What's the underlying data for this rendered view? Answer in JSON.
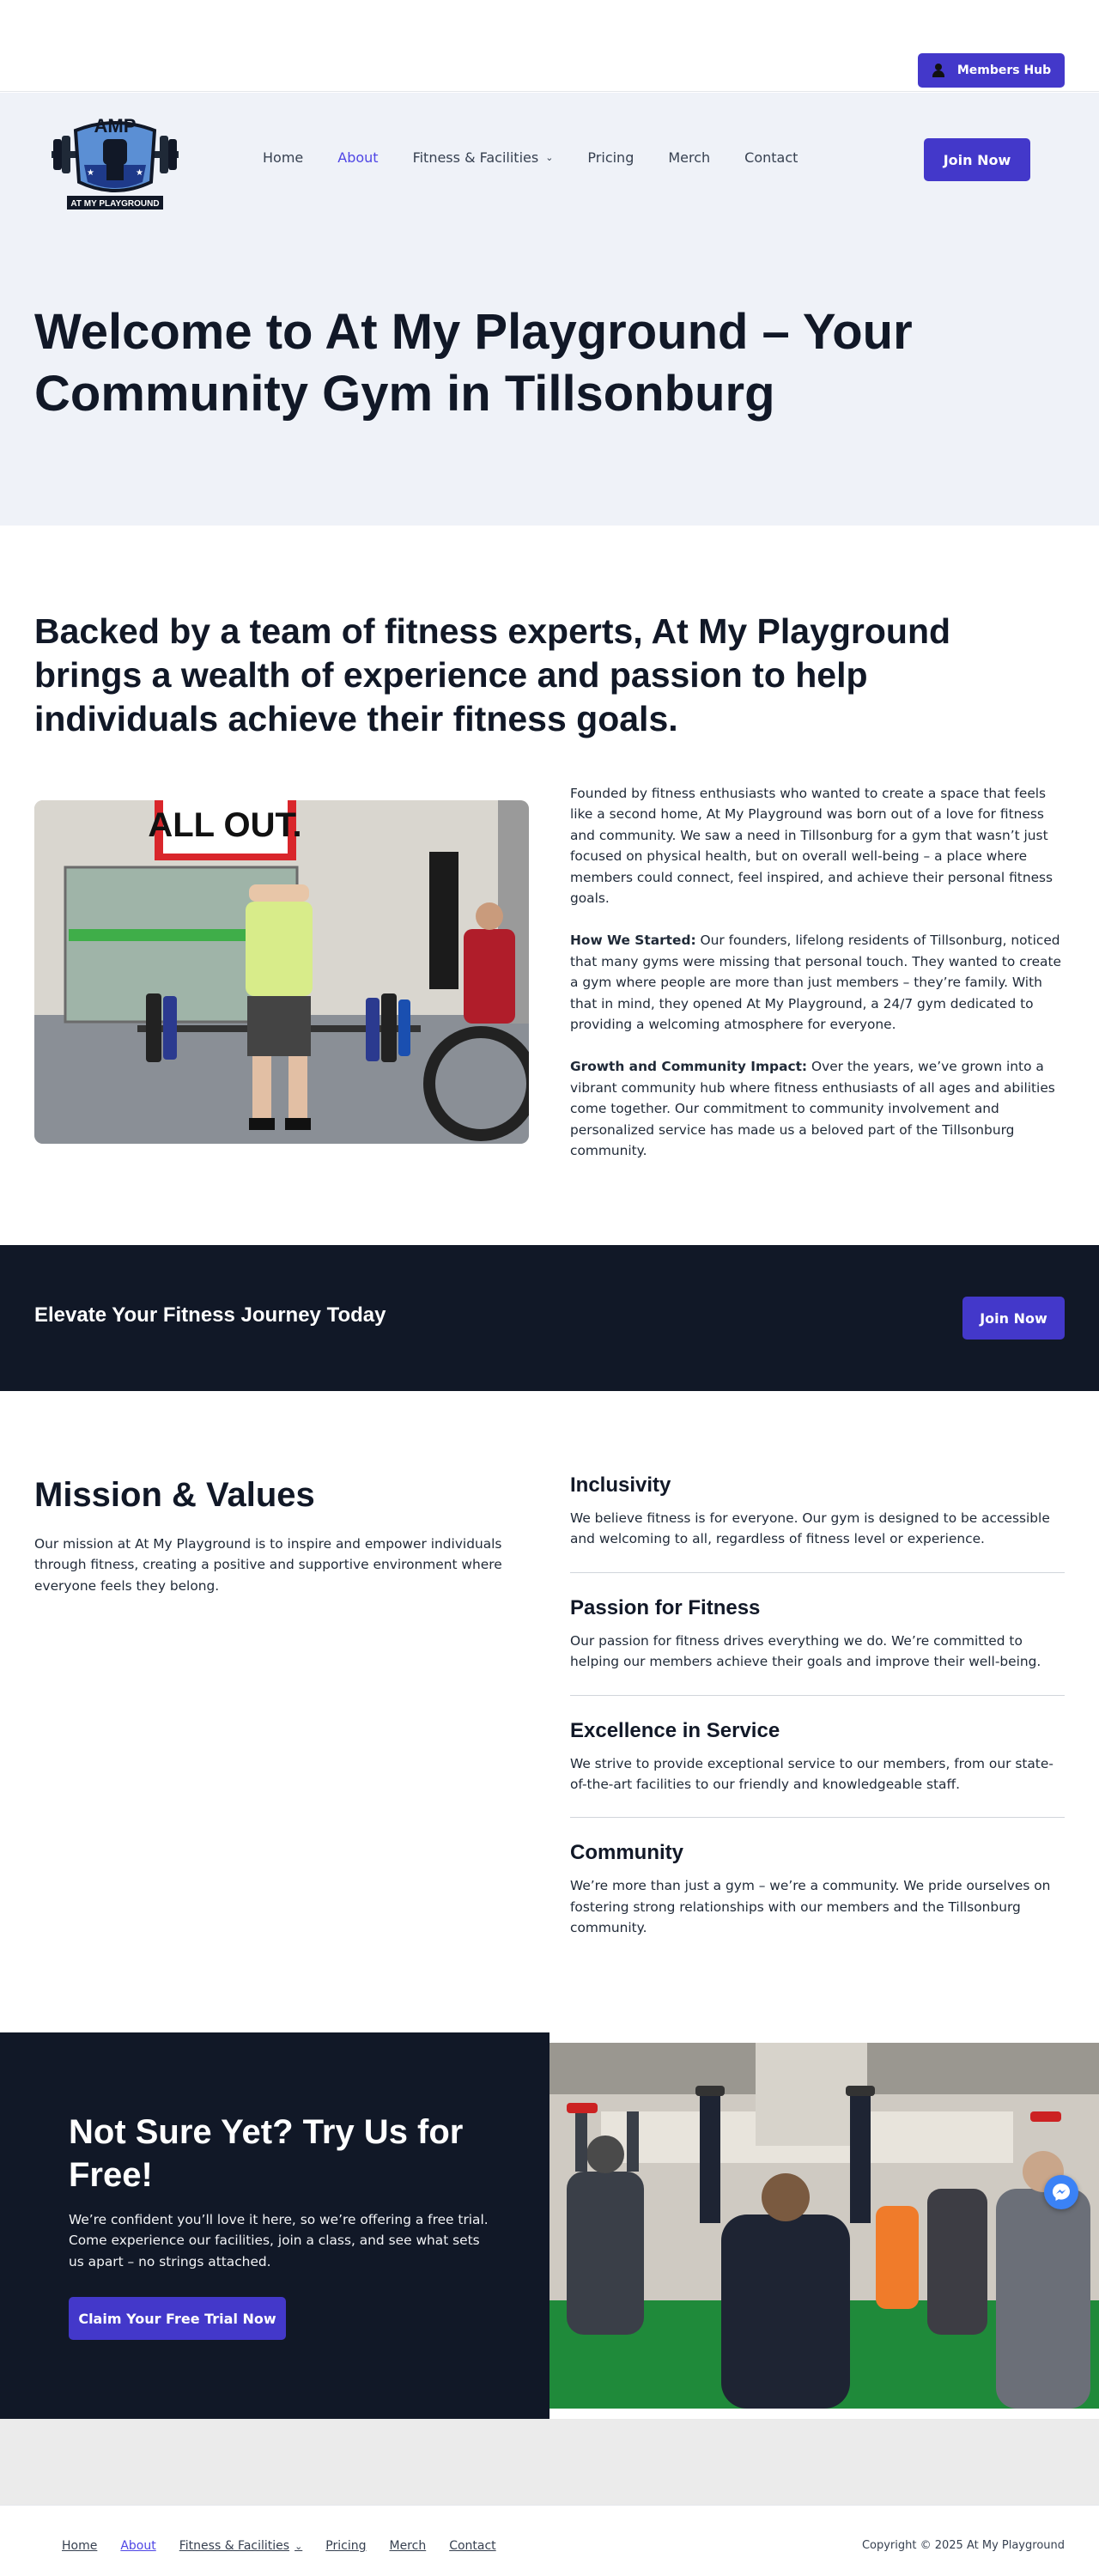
{
  "topbar": {
    "members_label": "Members Hub"
  },
  "logo": {
    "text_top": "AMP",
    "text_bottom": "AT MY PLAYGROUND"
  },
  "nav": {
    "items": [
      {
        "label": "Home"
      },
      {
        "label": "About",
        "active": true
      },
      {
        "label": "Fitness & Facilities",
        "dropdown": true
      },
      {
        "label": "Pricing"
      },
      {
        "label": "Merch"
      },
      {
        "label": "Contact"
      }
    ],
    "join_label": "Join Now"
  },
  "hero": {
    "title": "Welcome to At My Playground – Your Community Gym in Tillsonburg"
  },
  "about": {
    "heading": "Backed by a team of fitness experts, At My Playground brings a wealth of experience and passion to help individuals achieve their fitness goals.",
    "photo_sign": "ALL OUT.",
    "p1": "Founded by fitness enthusiasts who wanted to create a space that feels like a second home, At My Playground was born out of a love for fitness and community. We saw a need in Tillsonburg for a gym that wasn’t just focused on physical health, but on overall well-being – a place where members could connect, feel inspired, and achieve their personal fitness goals.",
    "p2_label": "How We Started:",
    "p2": " Our founders, lifelong residents of Tillsonburg, noticed that many gyms were missing that personal touch. They wanted to create a gym where people are more than just members – they’re family. With that in mind, they opened At My Playground, a 24/7 gym dedicated to providing a welcoming atmosphere for everyone.",
    "p3_label": "Growth and Community Impact:",
    "p3": " Over the years, we’ve grown into a vibrant community hub where fitness enthusiasts of all ages and abilities come together. Our commitment to community involvement and personalized service has made us a beloved part of the Tillsonburg community."
  },
  "cta": {
    "heading": "Elevate Your Fitness Journey Today",
    "button": "Join Now"
  },
  "mission": {
    "title": "Mission & Values",
    "text": "Our mission at At My Playground is to inspire and empower individuals through fitness, creating a positive and supportive environment where everyone feels they belong.",
    "values": [
      {
        "title": "Inclusivity",
        "text": "We believe fitness is for everyone. Our gym is designed to be accessible and welcoming to all, regardless of fitness level or experience."
      },
      {
        "title": "Passion for Fitness",
        "text": "Our passion for fitness drives everything we do. We’re committed to helping our members achieve their goals and improve their well-being."
      },
      {
        "title": "Excellence in Service",
        "text": "We strive to provide exceptional service to our members, from our state-of-the-art facilities to our friendly and knowledgeable staff."
      },
      {
        "title": "Community",
        "text": "We’re more than just a gym – we’re a community. We pride ourselves on fostering strong relationships with our members and the Tillsonburg community."
      }
    ]
  },
  "trial": {
    "heading": "Not Sure Yet? Try Us for Free!",
    "text": "We’re confident you’ll love it here, so we’re offering a free trial. Come experience our facilities, join a class, and see what sets us apart – no strings attached.",
    "button": "Claim Your Free Trial Now"
  },
  "footer": {
    "links": [
      {
        "label": "Home"
      },
      {
        "label": "About",
        "active": true
      },
      {
        "label": "Fitness & Facilities",
        "dropdown": true
      },
      {
        "label": "Pricing"
      },
      {
        "label": "Merch"
      },
      {
        "label": "Contact"
      }
    ],
    "copyright": "Copyright © 2025 At My Playground"
  },
  "colors": {
    "accent": "#4338ca",
    "dark": "#111827",
    "hero_bg": "#eff2f8",
    "link_active": "#4f46e5"
  }
}
